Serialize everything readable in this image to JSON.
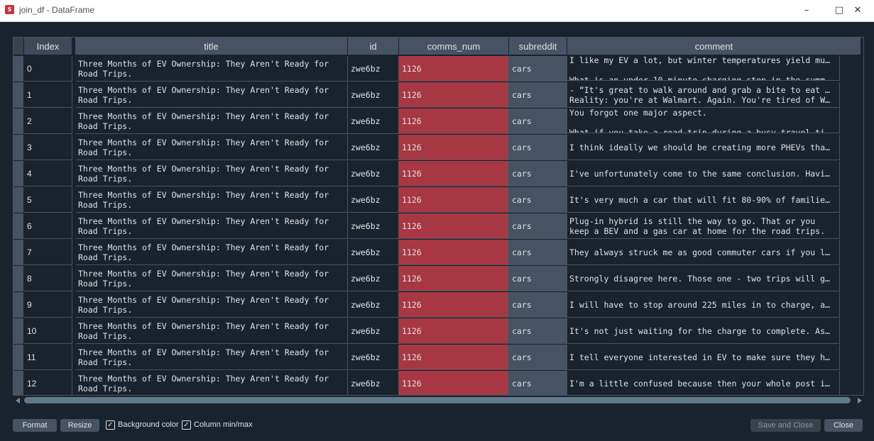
{
  "window": {
    "title": "join_df - DataFrame",
    "app_icon": "spyder-icon",
    "controls": [
      "minimize-icon",
      "maximize-icon",
      "close-icon"
    ]
  },
  "table": {
    "columns": [
      "Index",
      "title",
      "id",
      "comms_num",
      "subreddit",
      "comment"
    ],
    "rows": [
      {
        "index": "0",
        "title": "Three Months of EV Ownership: They Aren't Ready for\nRoad Trips.",
        "id": "zwe6bz",
        "comms_num": "1126",
        "subreddit": "cars",
        "comment": "I like my EV a lot, but winter temperatures yield mu…\n\nWhat is an under 10 minute charging stop in the summ…"
      },
      {
        "index": "1",
        "title": "Three Months of EV Ownership: They Aren't Ready for\nRoad Trips.",
        "id": "zwe6bz",
        "comms_num": "1126",
        "subreddit": "cars",
        "comment": "- “It's great to walk around and grab a bite to eat …\nReality: you're at Walmart. Again. You're tired of W…"
      },
      {
        "index": "2",
        "title": "Three Months of EV Ownership: They Aren't Ready for\nRoad Trips.",
        "id": "zwe6bz",
        "comms_num": "1126",
        "subreddit": "cars",
        "comment": "You forgot one major aspect.\n\nWhat if you take a road trip during a busy travel ti…"
      },
      {
        "index": "3",
        "title": "Three Months of EV Ownership: They Aren't Ready for\nRoad Trips.",
        "id": "zwe6bz",
        "comms_num": "1126",
        "subreddit": "cars",
        "comment": "I think ideally we should be creating more PHEVs tha…"
      },
      {
        "index": "4",
        "title": "Three Months of EV Ownership: They Aren't Ready for\nRoad Trips.",
        "id": "zwe6bz",
        "comms_num": "1126",
        "subreddit": "cars",
        "comment": "I've unfortunately come to the same conclusion. Havi…"
      },
      {
        "index": "5",
        "title": "Three Months of EV Ownership: They Aren't Ready for\nRoad Trips.",
        "id": "zwe6bz",
        "comms_num": "1126",
        "subreddit": "cars",
        "comment": "It's very much a car that will fit 80-90% of familie…"
      },
      {
        "index": "6",
        "title": "Three Months of EV Ownership: They Aren't Ready for\nRoad Trips.",
        "id": "zwe6bz",
        "comms_num": "1126",
        "subreddit": "cars",
        "comment": "Plug-in hybrid is still the way to go. That or you\nkeep a BEV and a gas car at home for the road trips."
      },
      {
        "index": "7",
        "title": "Three Months of EV Ownership: They Aren't Ready for\nRoad Trips.",
        "id": "zwe6bz",
        "comms_num": "1126",
        "subreddit": "cars",
        "comment": "They always struck me as good commuter cars if you l…"
      },
      {
        "index": "8",
        "title": "Three Months of EV Ownership: They Aren't Ready for\nRoad Trips.",
        "id": "zwe6bz",
        "comms_num": "1126",
        "subreddit": "cars",
        "comment": "Strongly disagree here. Those one - two trips will g…"
      },
      {
        "index": "9",
        "title": "Three Months of EV Ownership: They Aren't Ready for\nRoad Trips.",
        "id": "zwe6bz",
        "comms_num": "1126",
        "subreddit": "cars",
        "comment": "I will have to stop around 225 miles in to charge, a…"
      },
      {
        "index": "10",
        "title": "Three Months of EV Ownership: They Aren't Ready for\nRoad Trips.",
        "id": "zwe6bz",
        "comms_num": "1126",
        "subreddit": "cars",
        "comment": "It's not just waiting for the charge to complete. As…"
      },
      {
        "index": "11",
        "title": "Three Months of EV Ownership: They Aren't Ready for\nRoad Trips.",
        "id": "zwe6bz",
        "comms_num": "1126",
        "subreddit": "cars",
        "comment": "I tell everyone interested in EV to make sure they h…"
      },
      {
        "index": "12",
        "title": "Three Months of EV Ownership: They Aren't Ready for\nRoad Trips.",
        "id": "zwe6bz",
        "comms_num": "1126",
        "subreddit": "cars",
        "comment": "I'm a little confused because then your whole post i…"
      }
    ]
  },
  "footer": {
    "format_label": "Format",
    "resize_label": "Resize",
    "background_color_label": "Background color",
    "background_color_checked": true,
    "column_minmax_label": "Column min/max",
    "column_minmax_checked": true,
    "save_close_label": "Save and Close",
    "close_label": "Close"
  },
  "colors": {
    "background": "#19232d",
    "header": "#455364",
    "comms_num_highlight": "#a83744",
    "text": "#e0e1e3"
  }
}
